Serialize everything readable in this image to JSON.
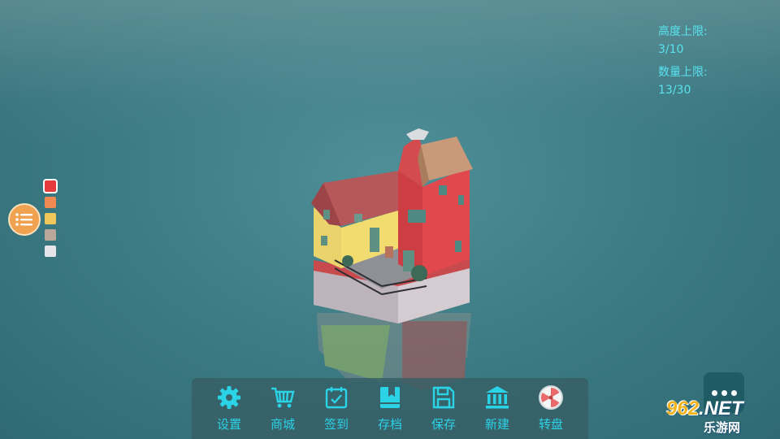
{
  "stats": {
    "height_label": "高度上限:",
    "height_value": "3/10",
    "count_label": "数量上限:",
    "count_value": "13/30"
  },
  "palette": {
    "colors": [
      "#e63b3b",
      "#f08a52",
      "#f2c75a",
      "#b8a79a",
      "#e6e6ea"
    ],
    "selected_index": 0
  },
  "toolbar": {
    "items": [
      {
        "label": "设置",
        "icon": "gear-icon"
      },
      {
        "label": "商城",
        "icon": "shopping-cart-icon"
      },
      {
        "label": "签到",
        "icon": "calendar-check-icon"
      },
      {
        "label": "存档",
        "icon": "book-bookmark-icon"
      },
      {
        "label": "保存",
        "icon": "floppy-disk-icon"
      },
      {
        "label": "新建",
        "icon": "bank-building-icon"
      },
      {
        "label": "转盘",
        "icon": "spin-wheel-icon"
      }
    ]
  },
  "watermark": {
    "brand": "962",
    "suffix": ".NET",
    "subtitle": "乐游网"
  },
  "colors": {
    "accent": "#2bd3e6",
    "stats_text": "#58e3ef",
    "menu_button": "#f0a250"
  }
}
